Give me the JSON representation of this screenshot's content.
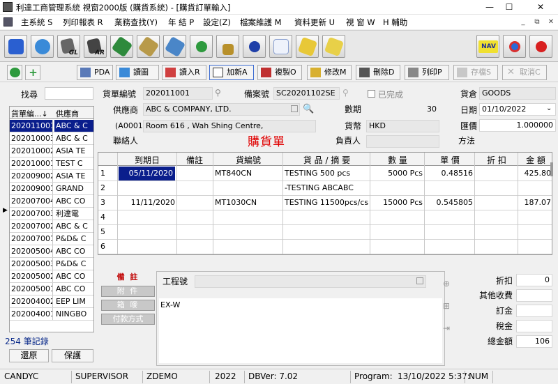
{
  "window": {
    "title": "利達工商管理系統 視窗2000版 (購貨系統) - [購貨訂單輸入]",
    "min": "—",
    "max": "☐",
    "close": "✕"
  },
  "menu": [
    "主系統 S",
    "列印報表 R",
    "業務查找(Y)",
    "年 結 P",
    "設定(Z)",
    "檔案維護 M",
    "資料更新 U",
    "視 窗 W",
    "H 輔助"
  ],
  "mdi": [
    "_",
    "⧉",
    "✕"
  ],
  "toolbar": {
    "gl": "GL",
    "ar": "AR",
    "nav": "NAV",
    "list": "01\n02\n03"
  },
  "actions": {
    "pda": "PDA",
    "read_pic": "讀圖",
    "load": "讀入R",
    "add_new": "加新A",
    "copy": "複製O",
    "modify": "修改M",
    "delete": "刪除D",
    "print": "列印P",
    "save": "存檔S",
    "cancel": "取消C"
  },
  "search": {
    "label": "找尋"
  },
  "order_list": {
    "headers": [
      "貨單編...↓",
      "供應商"
    ],
    "rows": [
      [
        "202011001",
        "ABC & C"
      ],
      [
        "202010003",
        "ABC & C"
      ],
      [
        "202010002",
        "ASIA TE"
      ],
      [
        "202010001",
        "TEST C"
      ],
      [
        "202009002",
        "ASIA TE"
      ],
      [
        "202009001",
        "GRAND"
      ],
      [
        "202007004",
        "ABC CO"
      ],
      [
        "202007003",
        "利達電"
      ],
      [
        "202007002",
        "ABC & C"
      ],
      [
        "202007001",
        "P&D& C"
      ],
      [
        "202005004",
        "ABC CO"
      ],
      [
        "202005003",
        "P&D& C"
      ],
      [
        "202005002",
        "ABC CO"
      ],
      [
        "202005001",
        "ABC CO"
      ],
      [
        "202004002",
        "EEP LIM"
      ],
      [
        "202004001",
        "NINGBO"
      ]
    ],
    "count": "254 筆記錄",
    "restore": "還原",
    "keep": "保護"
  },
  "form": {
    "order_no_label": "貨單編號",
    "order_no": "202011001",
    "record_no_label": "備案號",
    "record_no": "SC20201102SE",
    "completed_label": "已完成",
    "warehouse_label": "貨倉",
    "warehouse": "GOODS",
    "supplier_label": "供應商",
    "supplier": "ABC & COMPANY, LTD.",
    "period_label": "數期",
    "period": "30",
    "date_label": "日期",
    "date": "01/10/2022",
    "supplier_code": "(A0001)",
    "address": "Room 616 , Wah Shing Centre,",
    "currency_label": "貨幣",
    "currency": "HKD",
    "rate_label": "匯價",
    "rate": "1.000000",
    "contact_label": "聯絡人",
    "responsible_label": "負責人",
    "method_label": "方法",
    "doc_title": "購貨單"
  },
  "line_grid": {
    "headers": [
      "到期日",
      "備註",
      "貨編號",
      "貨 品 / 摘 要",
      "數 量",
      "單 價",
      "折 扣",
      "金 額"
    ],
    "rows": [
      {
        "n": "1",
        "due": "05/11/2020",
        "item": "MT840CN",
        "desc": "TESTING 500 pcs",
        "qty": "5000 Pcs",
        "price": "0.48516",
        "amount": "425.80"
      },
      {
        "n": "2",
        "due": "",
        "item": "",
        "desc": "-TESTING ABCABC",
        "qty": "",
        "price": "",
        "amount": ""
      },
      {
        "n": "3",
        "due": "11/11/2020",
        "item": "MT1030CN",
        "desc": "TESTING 11500pcs/cs",
        "qty": "15000 Pcs",
        "price": "0.545805",
        "amount": "187.07"
      },
      {
        "n": "4",
        "due": "",
        "item": "",
        "desc": "",
        "qty": "",
        "price": "",
        "amount": ""
      },
      {
        "n": "5",
        "due": "",
        "item": "",
        "desc": "",
        "qty": "",
        "price": "",
        "amount": ""
      },
      {
        "n": "6",
        "due": "",
        "item": "",
        "desc": "",
        "qty": "",
        "price": "",
        "amount": ""
      }
    ]
  },
  "bottom": {
    "tabs": [
      "備 註",
      "附 件",
      "箱 嘜",
      "付款方式"
    ],
    "project_label": "工程號",
    "note": "EX-W",
    "discount_label": "折扣",
    "discount": "0",
    "other_label": "其他收費",
    "subtotal_label": "訂金",
    "tax_label": "稅金",
    "total_label": "總金額",
    "total": "106"
  },
  "status": {
    "user": "CANDYC",
    "role": "SUPERVISOR",
    "db": "ZDEMO",
    "year": "2022",
    "dbver": "DBVer: 7.02",
    "program_label": "Program:",
    "program": "13/10/2022 5:37:",
    "num": "NUM"
  }
}
